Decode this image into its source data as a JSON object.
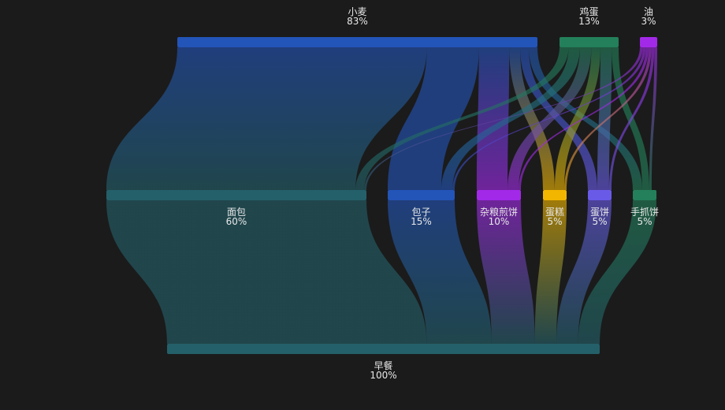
{
  "chart_data": {
    "type": "sankey",
    "title": "",
    "levels": [
      [
        "wheat",
        "egg",
        "oil"
      ],
      [
        "bread",
        "baozi",
        "jianbing",
        "cake",
        "eggcake",
        "shouzhuabing"
      ],
      [
        "breakfast"
      ]
    ],
    "nodes": [
      {
        "id": "wheat",
        "name": "小麦",
        "percent": "83%",
        "value": 83,
        "color": "#2354b8"
      },
      {
        "id": "egg",
        "name": "鸡蛋",
        "percent": "13%",
        "value": 13,
        "color": "#23805a"
      },
      {
        "id": "oil",
        "name": "油",
        "percent": "3%",
        "value": 3,
        "color": "#a329e8"
      },
      {
        "id": "bread",
        "name": "面包",
        "percent": "60%",
        "value": 60,
        "color": "#24606a"
      },
      {
        "id": "baozi",
        "name": "包子",
        "percent": "15%",
        "value": 15,
        "color": "#2354b8"
      },
      {
        "id": "jianbing",
        "name": "杂粮煎饼",
        "percent": "10%",
        "value": 10,
        "color": "#a329e8"
      },
      {
        "id": "cake",
        "name": "蛋糕",
        "percent": "5%",
        "value": 5,
        "color": "#f2b600"
      },
      {
        "id": "eggcake",
        "name": "蛋饼",
        "percent": "5%",
        "value": 5,
        "color": "#6a5ae8"
      },
      {
        "id": "shouzhuabing",
        "name": "手抓饼",
        "percent": "5%",
        "value": 5,
        "color": "#23805a"
      },
      {
        "id": "breakfast",
        "name": "早餐",
        "percent": "100%",
        "value": 100,
        "color": "#24606a"
      }
    ],
    "links": [
      {
        "source": "wheat",
        "target": "bread",
        "value": 57.5
      },
      {
        "source": "wheat",
        "target": "baozi",
        "value": 12
      },
      {
        "source": "wheat",
        "target": "jianbing",
        "value": 7
      },
      {
        "source": "wheat",
        "target": "cake",
        "value": 2.5
      },
      {
        "source": "wheat",
        "target": "eggcake",
        "value": 2
      },
      {
        "source": "wheat",
        "target": "shouzhuabing",
        "value": 2
      },
      {
        "source": "egg",
        "target": "bread",
        "value": 2
      },
      {
        "source": "egg",
        "target": "baozi",
        "value": 2.5
      },
      {
        "source": "egg",
        "target": "jianbing",
        "value": 2.5
      },
      {
        "source": "egg",
        "target": "cake",
        "value": 2
      },
      {
        "source": "egg",
        "target": "eggcake",
        "value": 2.5
      },
      {
        "source": "egg",
        "target": "shouzhuabing",
        "value": 1.5
      },
      {
        "source": "oil",
        "target": "bread",
        "value": 0.5
      },
      {
        "source": "oil",
        "target": "baozi",
        "value": 0.5
      },
      {
        "source": "oil",
        "target": "jianbing",
        "value": 0.5
      },
      {
        "source": "oil",
        "target": "cake",
        "value": 0.5
      },
      {
        "source": "oil",
        "target": "eggcake",
        "value": 0.5
      },
      {
        "source": "oil",
        "target": "shouzhuabing",
        "value": 0.5
      },
      {
        "source": "bread",
        "target": "breakfast",
        "value": 60
      },
      {
        "source": "baozi",
        "target": "breakfast",
        "value": 15
      },
      {
        "source": "jianbing",
        "target": "breakfast",
        "value": 10
      },
      {
        "source": "cake",
        "target": "breakfast",
        "value": 5
      },
      {
        "source": "eggcake",
        "target": "breakfast",
        "value": 5
      },
      {
        "source": "shouzhuabing",
        "target": "breakfast",
        "value": 5
      }
    ],
    "background": "#1b1b1b",
    "legend": "none",
    "grid": false
  }
}
